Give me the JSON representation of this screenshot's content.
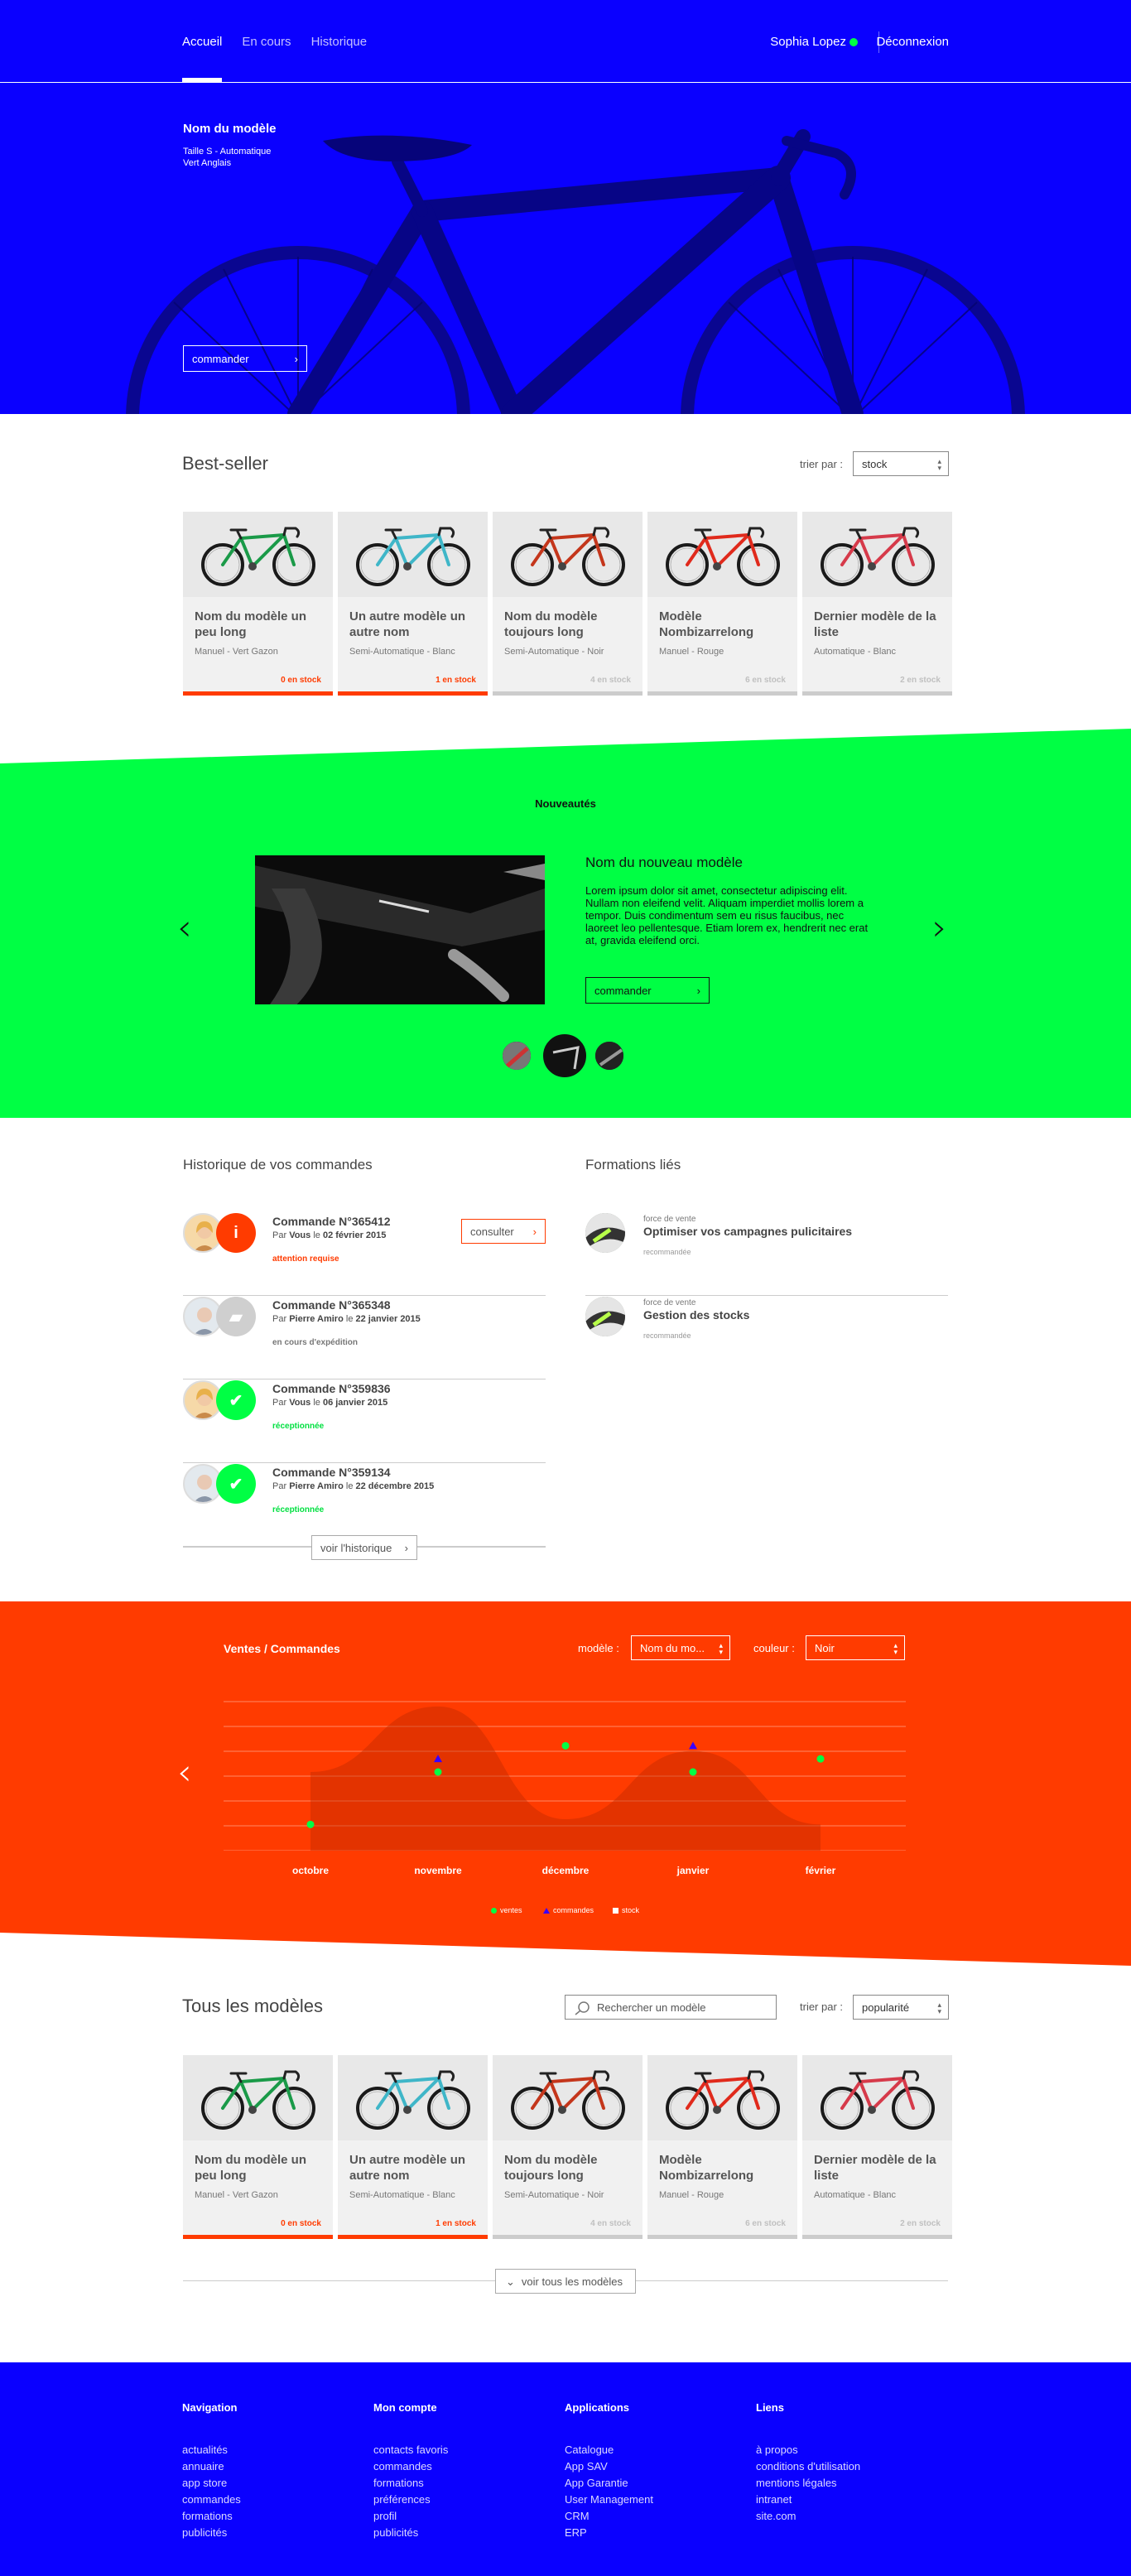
{
  "nav": {
    "links": [
      {
        "label": "Accueil"
      },
      {
        "label": "En cours"
      },
      {
        "label": "Historique"
      }
    ],
    "user": "Sophia Lopez",
    "logout": "Déconnexion"
  },
  "hero": {
    "model_name": "Nom du modèle",
    "size": "Taille S - Automatique",
    "color": "Vert Anglais",
    "cta": "commander"
  },
  "bestseller": {
    "title": "Best-seller",
    "sort_label": "trier par :",
    "sort_value": "stock",
    "cards": [
      {
        "name": "Nom du modèle un peu long",
        "desc": "Manuel - Vert Gazon",
        "stock": "0 en stock",
        "frame": "#1a9a48",
        "hot": true
      },
      {
        "name": "Un autre modèle un autre nom",
        "desc": "Semi-Automatique - Blanc",
        "stock": "1 en stock",
        "frame": "#3fb6c8",
        "hot": true
      },
      {
        "name": "Nom du modèle toujours long",
        "desc": "Semi-Automatique - Noir",
        "stock": "4 en stock",
        "frame": "#c4361b",
        "hot": false
      },
      {
        "name": "Modèle Nombizarrelong",
        "desc": "Manuel - Rouge",
        "stock": "6 en stock",
        "frame": "#e02a1c",
        "hot": false
      },
      {
        "name": "Dernier modèle de la liste",
        "desc": "Automatique - Blanc",
        "stock": "2 en stock",
        "frame": "#d63a4a",
        "hot": false
      }
    ]
  },
  "news": {
    "title": "Nouveautés",
    "name": "Nom du nouveau modèle",
    "text": "Lorem ipsum dolor sit amet, consectetur adipiscing elit. Nullam non eleifend velit. Aliquam imperdiet mollis lorem a tempor. Duis condimentum sem eu risus faucibus, nec laoreet leo pellentesque. Etiam lorem ex, hendrerit nec erat at, gravida eleifend orci.",
    "cta": "commander"
  },
  "history": {
    "title": "Historique de vos commandes",
    "orders": [
      {
        "num": "Commande N°365412",
        "by_prefix": "Par",
        "by": "Vous",
        "date_prefix": "le",
        "date": "02 février 2015",
        "status": "attention requise",
        "status_color": "#ff3b00",
        "badge_color": "#ff3b00",
        "badge": "i",
        "action": "consulter"
      },
      {
        "num": "Commande N°365348",
        "by_prefix": "Par",
        "by": "Pierre Amiro",
        "date_prefix": "le",
        "date": "22 janvier 2015",
        "status": "en cours d'expédition",
        "status_color": "#777",
        "badge_color": "#cfcfcf",
        "badge": "▰"
      },
      {
        "num": "Commande N°359836",
        "by_prefix": "Par",
        "by": "Vous",
        "date_prefix": "le",
        "date": "06 janvier 2015",
        "status": "réceptionnée",
        "status_color": "#00e040",
        "badge_color": "#00ff44",
        "badge": "✔"
      },
      {
        "num": "Commande N°359134",
        "by_prefix": "Par",
        "by": "Pierre Amiro",
        "date_prefix": "le",
        "date": "22 décembre 2015",
        "status": "réceptionnée",
        "status_color": "#00e040",
        "badge_color": "#00ff44",
        "badge": "✔"
      }
    ],
    "more": "voir l'historique"
  },
  "trainings": {
    "title": "Formations liés",
    "items": [
      {
        "category": "force de vente",
        "title": "Optimiser vos campagnes pulicitaires",
        "tag": "recommandée"
      },
      {
        "category": "force de vente",
        "title": "Gestion des stocks",
        "tag": "recommandée"
      }
    ]
  },
  "sales": {
    "title": "Ventes / Commandes",
    "model_label": "modèle :",
    "model_value": "Nom du mo...",
    "color_label": "couleur :",
    "color_value": "Noir",
    "legend": [
      {
        "label": "ventes",
        "color": "#00ff44"
      },
      {
        "label": "commandes",
        "color": "#3a00ff"
      },
      {
        "label": "stock",
        "color": "#ffffff"
      }
    ]
  },
  "chart_data": {
    "type": "line",
    "categories": [
      "octobre",
      "novembre",
      "décembre",
      "janvier",
      "février"
    ],
    "series": [
      {
        "name": "ventes",
        "values": [
          1,
          3,
          4,
          3,
          3.5
        ]
      },
      {
        "name": "commandes",
        "values": [
          null,
          3.5,
          null,
          4,
          null
        ]
      },
      {
        "name": "stock",
        "values": [
          3,
          5.5,
          1.2,
          3.8,
          1
        ]
      }
    ],
    "ylim": [
      0,
      6
    ],
    "grid": true,
    "legend": "bottom"
  },
  "all_models": {
    "title": "Tous les modèles",
    "search_placeholder": "Rechercher un modèle",
    "sort_label": "trier par :",
    "sort_value": "popularité",
    "more": "voir tous les modèles"
  },
  "footer": {
    "cols": [
      {
        "title": "Navigation",
        "items": [
          "actualités",
          "annuaire",
          "app store",
          "commandes",
          "formations",
          "publicités"
        ]
      },
      {
        "title": "Mon compte",
        "items": [
          "contacts favoris",
          "commandes",
          "formations",
          "préférences",
          "profil",
          "publicités"
        ]
      },
      {
        "title": "Applications",
        "items": [
          "Catalogue",
          "App SAV",
          "App Garantie",
          "User Management",
          "CRM",
          "ERP"
        ]
      },
      {
        "title": "Liens",
        "items": [
          "à propos",
          "conditions d'utilisation",
          "mentions légales",
          "intranet",
          "site.com"
        ]
      }
    ]
  }
}
